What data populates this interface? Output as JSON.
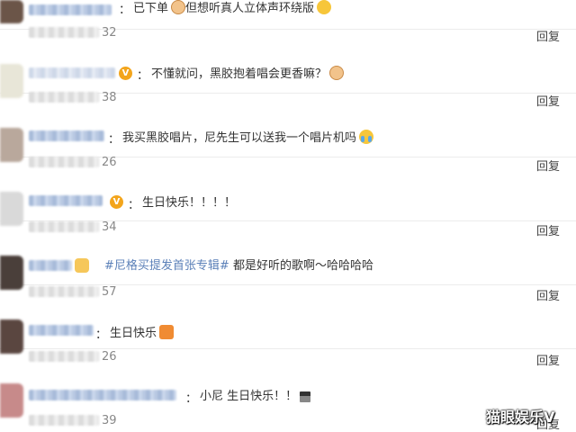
{
  "comments": [
    {
      "text": "已下单",
      "text2": "但想听真人立体声环绕版",
      "likes": "32",
      "reply": "回复"
    },
    {
      "text": "不懂就问，黑胶抱着唱会更香嘛？",
      "likes": "38",
      "reply": "回复"
    },
    {
      "text": "我买黑胶唱片，尼先生可以送我一个唱片机吗",
      "likes": "26",
      "reply": "回复"
    },
    {
      "text": "生日快乐！！！！",
      "likes": "34",
      "reply": "回复"
    },
    {
      "topic": "#尼格买提发首张专辑#",
      "text": "都是好听的歌啊～哈哈哈哈",
      "likes": "57",
      "reply": "回复"
    },
    {
      "text": "生日快乐",
      "likes": "26",
      "reply": "回复"
    },
    {
      "text": "小尼 生日快乐！！",
      "likes": "39",
      "reply": "回复"
    }
  ],
  "colon": "：",
  "verified_badge": "V",
  "watermark": "猫眼娱乐V",
  "colors": {
    "topic": "#5b80b8",
    "verified": "#f3a51c",
    "reply": "#444444",
    "likes": "#888888"
  }
}
